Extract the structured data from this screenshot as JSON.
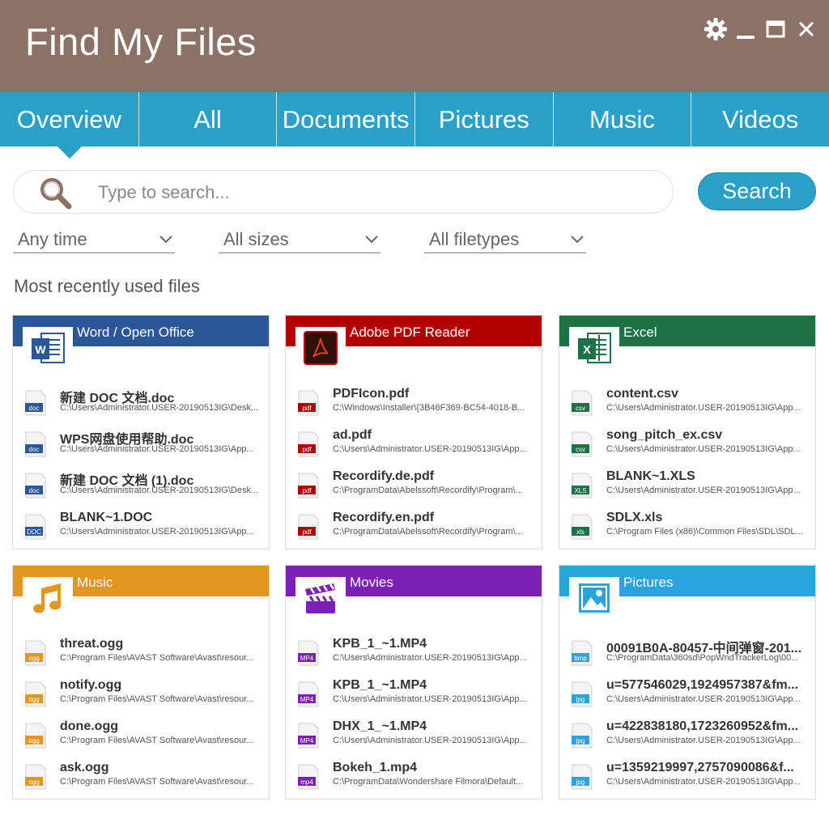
{
  "app": {
    "title": "Find My Files"
  },
  "window_controls": [
    {
      "name": "settings",
      "icon": "gear-icon"
    },
    {
      "name": "minimize",
      "icon": "minimize-icon"
    },
    {
      "name": "maximize",
      "icon": "maximize-icon"
    },
    {
      "name": "close",
      "icon": "close-icon"
    }
  ],
  "tabs": [
    {
      "label": "Overview",
      "active": true
    },
    {
      "label": "All"
    },
    {
      "label": "Documents"
    },
    {
      "label": "Pictures"
    },
    {
      "label": "Music"
    },
    {
      "label": "Videos"
    }
  ],
  "search": {
    "placeholder": "Type to search...",
    "value": "",
    "button_label": "Search"
  },
  "filters": {
    "time": "Any time",
    "size": "All sizes",
    "filetype": "All filetypes"
  },
  "section_title": "Most recently used files",
  "colors": {
    "titlebar": "#8b7266",
    "accent": "#2aa0c9",
    "word": "#2b5797",
    "pdf": "#b00000",
    "excel": "#1e7145",
    "music": "#e0961f",
    "movies": "#7b1fb7",
    "pictures": "#2ba3dc"
  },
  "cards": [
    {
      "key": "word",
      "title": "Word / Open Office",
      "icon": "word-icon",
      "color": "#2b5797",
      "files": [
        {
          "name": "新建 DOC 文档.doc",
          "path": "C:\\Users\\Administrator.USER-20190513IG\\Desk...",
          "ext": "doc"
        },
        {
          "name": "WPS网盘使用帮助.doc",
          "path": "C:\\Users\\Administrator.USER-20190513IG\\App...",
          "ext": "doc"
        },
        {
          "name": "新建 DOC 文档 (1).doc",
          "path": "C:\\Users\\Administrator.USER-20190513IG\\Desk...",
          "ext": "doc"
        },
        {
          "name": "BLANK~1.DOC",
          "path": "C:\\Users\\Administrator.USER-20190513IG\\App...",
          "ext": "DOC"
        }
      ]
    },
    {
      "key": "pdf",
      "title": "Adobe PDF Reader",
      "icon": "pdf-icon",
      "color": "#b00000",
      "files": [
        {
          "name": "PDFIcon.pdf",
          "path": "C:\\Windows\\Installer\\{3B46F369-BC54-4018-B...",
          "ext": "pdf"
        },
        {
          "name": "ad.pdf",
          "path": "C:\\Users\\Administrator.USER-20190513IG\\App...",
          "ext": "pdf"
        },
        {
          "name": "Recordify.de.pdf",
          "path": "C:\\ProgramData\\Abelssoft\\Recordify\\Program\\...",
          "ext": "pdf"
        },
        {
          "name": "Recordify.en.pdf",
          "path": "C:\\ProgramData\\Abelssoft\\Recordify\\Program\\...",
          "ext": "pdf"
        }
      ]
    },
    {
      "key": "excel",
      "title": "Excel",
      "icon": "excel-icon",
      "color": "#1e7145",
      "files": [
        {
          "name": "content.csv",
          "path": "C:\\Users\\Administrator.USER-20190513IG\\App...",
          "ext": "csv"
        },
        {
          "name": "song_pitch_ex.csv",
          "path": "C:\\Users\\Administrator.USER-20190513IG\\App...",
          "ext": "csv"
        },
        {
          "name": "BLANK~1.XLS",
          "path": "C:\\Users\\Administrator.USER-20190513IG\\App...",
          "ext": "XLS"
        },
        {
          "name": "SDLX.xls",
          "path": "C:\\Program Files (x86)\\Common Files\\SDL\\SDL...",
          "ext": "xls"
        }
      ]
    },
    {
      "key": "music",
      "title": "Music",
      "icon": "music-note-icon",
      "color": "#e0961f",
      "files": [
        {
          "name": "threat.ogg",
          "path": "C:\\Program Files\\AVAST Software\\Avast\\resour...",
          "ext": "ogg"
        },
        {
          "name": "notify.ogg",
          "path": "C:\\Program Files\\AVAST Software\\Avast\\resour...",
          "ext": "ogg"
        },
        {
          "name": "done.ogg",
          "path": "C:\\Program Files\\AVAST Software\\Avast\\resour...",
          "ext": "ogg"
        },
        {
          "name": "ask.ogg",
          "path": "C:\\Program Files\\AVAST Software\\Avast\\resour...",
          "ext": "ogg"
        }
      ]
    },
    {
      "key": "movies",
      "title": "Movies",
      "icon": "clapperboard-icon",
      "color": "#7b1fb7",
      "files": [
        {
          "name": "KPB_1_~1.MP4",
          "path": "C:\\Users\\Administrator.USER-20190513IG\\App...",
          "ext": "MP4"
        },
        {
          "name": "KPB_1_~1.MP4",
          "path": "C:\\Users\\Administrator.USER-20190513IG\\App...",
          "ext": "MP4"
        },
        {
          "name": "DHX_1_~1.MP4",
          "path": "C:\\Users\\Administrator.USER-20190513IG\\App...",
          "ext": "MP4"
        },
        {
          "name": "Bokeh_1.mp4",
          "path": "C:\\ProgramData\\Wondershare Filmora\\Default...",
          "ext": "mp4"
        }
      ]
    },
    {
      "key": "pictures",
      "title": "Pictures",
      "icon": "picture-icon",
      "color": "#2ba3dc",
      "files": [
        {
          "name": "00091B0A-80457-中间弹窗-201...",
          "path": "C:\\ProgramData\\360sd\\PopWndTrackerLog\\00...",
          "ext": "bmp"
        },
        {
          "name": "u=577546029,1924957387&fm...",
          "path": "C:\\Users\\Administrator.USER-20190513IG\\App...",
          "ext": "jpg"
        },
        {
          "name": "u=422838180,1723260952&fm...",
          "path": "C:\\Users\\Administrator.USER-20190513IG\\App...",
          "ext": "jpg"
        },
        {
          "name": "u=1359219997,2757090086&f...",
          "path": "C:\\Users\\Administrator.USER-20190513IG\\App...",
          "ext": "jpg"
        }
      ]
    }
  ]
}
